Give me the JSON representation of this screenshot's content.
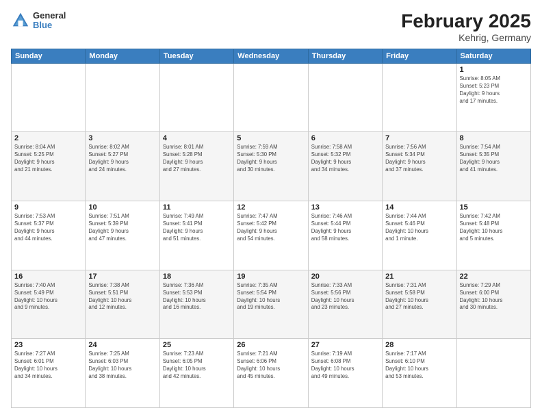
{
  "header": {
    "logo_general": "General",
    "logo_blue": "Blue",
    "title": "February 2025",
    "subtitle": "Kehrig, Germany"
  },
  "days_of_week": [
    "Sunday",
    "Monday",
    "Tuesday",
    "Wednesday",
    "Thursday",
    "Friday",
    "Saturday"
  ],
  "weeks": [
    {
      "days": [
        {
          "num": "",
          "info": ""
        },
        {
          "num": "",
          "info": ""
        },
        {
          "num": "",
          "info": ""
        },
        {
          "num": "",
          "info": ""
        },
        {
          "num": "",
          "info": ""
        },
        {
          "num": "",
          "info": ""
        },
        {
          "num": "1",
          "info": "Sunrise: 8:05 AM\nSunset: 5:23 PM\nDaylight: 9 hours\nand 17 minutes."
        }
      ]
    },
    {
      "days": [
        {
          "num": "2",
          "info": "Sunrise: 8:04 AM\nSunset: 5:25 PM\nDaylight: 9 hours\nand 21 minutes."
        },
        {
          "num": "3",
          "info": "Sunrise: 8:02 AM\nSunset: 5:27 PM\nDaylight: 9 hours\nand 24 minutes."
        },
        {
          "num": "4",
          "info": "Sunrise: 8:01 AM\nSunset: 5:28 PM\nDaylight: 9 hours\nand 27 minutes."
        },
        {
          "num": "5",
          "info": "Sunrise: 7:59 AM\nSunset: 5:30 PM\nDaylight: 9 hours\nand 30 minutes."
        },
        {
          "num": "6",
          "info": "Sunrise: 7:58 AM\nSunset: 5:32 PM\nDaylight: 9 hours\nand 34 minutes."
        },
        {
          "num": "7",
          "info": "Sunrise: 7:56 AM\nSunset: 5:34 PM\nDaylight: 9 hours\nand 37 minutes."
        },
        {
          "num": "8",
          "info": "Sunrise: 7:54 AM\nSunset: 5:35 PM\nDaylight: 9 hours\nand 41 minutes."
        }
      ]
    },
    {
      "days": [
        {
          "num": "9",
          "info": "Sunrise: 7:53 AM\nSunset: 5:37 PM\nDaylight: 9 hours\nand 44 minutes."
        },
        {
          "num": "10",
          "info": "Sunrise: 7:51 AM\nSunset: 5:39 PM\nDaylight: 9 hours\nand 47 minutes."
        },
        {
          "num": "11",
          "info": "Sunrise: 7:49 AM\nSunset: 5:41 PM\nDaylight: 9 hours\nand 51 minutes."
        },
        {
          "num": "12",
          "info": "Sunrise: 7:47 AM\nSunset: 5:42 PM\nDaylight: 9 hours\nand 54 minutes."
        },
        {
          "num": "13",
          "info": "Sunrise: 7:46 AM\nSunset: 5:44 PM\nDaylight: 9 hours\nand 58 minutes."
        },
        {
          "num": "14",
          "info": "Sunrise: 7:44 AM\nSunset: 5:46 PM\nDaylight: 10 hours\nand 1 minute."
        },
        {
          "num": "15",
          "info": "Sunrise: 7:42 AM\nSunset: 5:48 PM\nDaylight: 10 hours\nand 5 minutes."
        }
      ]
    },
    {
      "days": [
        {
          "num": "16",
          "info": "Sunrise: 7:40 AM\nSunset: 5:49 PM\nDaylight: 10 hours\nand 9 minutes."
        },
        {
          "num": "17",
          "info": "Sunrise: 7:38 AM\nSunset: 5:51 PM\nDaylight: 10 hours\nand 12 minutes."
        },
        {
          "num": "18",
          "info": "Sunrise: 7:36 AM\nSunset: 5:53 PM\nDaylight: 10 hours\nand 16 minutes."
        },
        {
          "num": "19",
          "info": "Sunrise: 7:35 AM\nSunset: 5:54 PM\nDaylight: 10 hours\nand 19 minutes."
        },
        {
          "num": "20",
          "info": "Sunrise: 7:33 AM\nSunset: 5:56 PM\nDaylight: 10 hours\nand 23 minutes."
        },
        {
          "num": "21",
          "info": "Sunrise: 7:31 AM\nSunset: 5:58 PM\nDaylight: 10 hours\nand 27 minutes."
        },
        {
          "num": "22",
          "info": "Sunrise: 7:29 AM\nSunset: 6:00 PM\nDaylight: 10 hours\nand 30 minutes."
        }
      ]
    },
    {
      "days": [
        {
          "num": "23",
          "info": "Sunrise: 7:27 AM\nSunset: 6:01 PM\nDaylight: 10 hours\nand 34 minutes."
        },
        {
          "num": "24",
          "info": "Sunrise: 7:25 AM\nSunset: 6:03 PM\nDaylight: 10 hours\nand 38 minutes."
        },
        {
          "num": "25",
          "info": "Sunrise: 7:23 AM\nSunset: 6:05 PM\nDaylight: 10 hours\nand 42 minutes."
        },
        {
          "num": "26",
          "info": "Sunrise: 7:21 AM\nSunset: 6:06 PM\nDaylight: 10 hours\nand 45 minutes."
        },
        {
          "num": "27",
          "info": "Sunrise: 7:19 AM\nSunset: 6:08 PM\nDaylight: 10 hours\nand 49 minutes."
        },
        {
          "num": "28",
          "info": "Sunrise: 7:17 AM\nSunset: 6:10 PM\nDaylight: 10 hours\nand 53 minutes."
        },
        {
          "num": "",
          "info": ""
        }
      ]
    }
  ]
}
